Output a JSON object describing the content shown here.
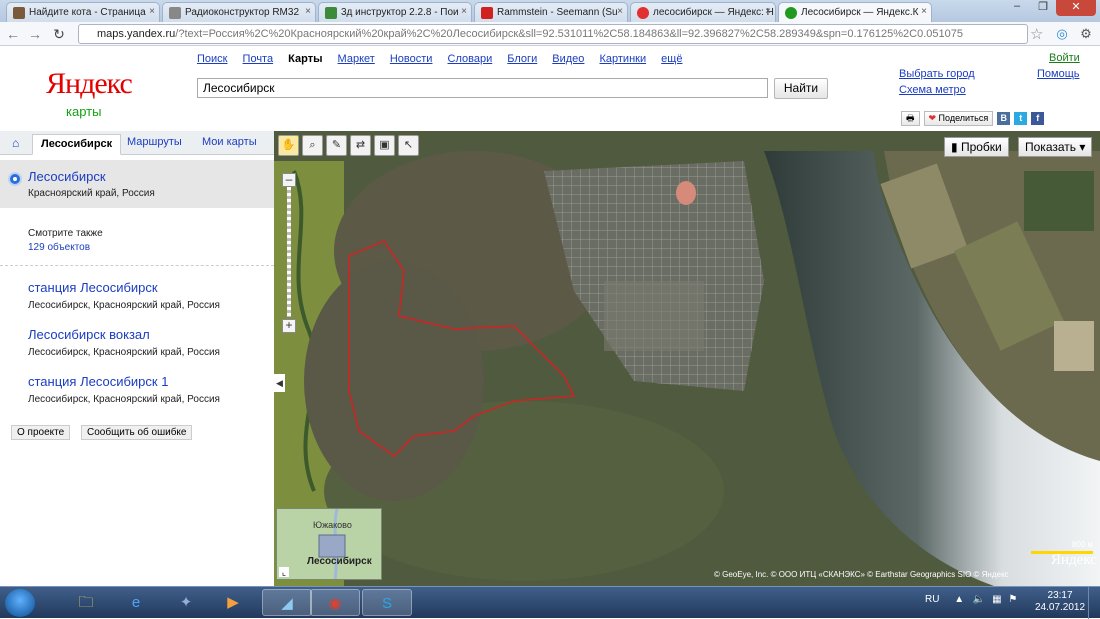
{
  "browser": {
    "tabs": [
      {
        "title": "Найдите кота - Страница",
        "favicon_color": "#7a5a3a"
      },
      {
        "title": "Радиоконструктор RM32",
        "favicon_color": "#888888"
      },
      {
        "title": "3д инструктор 2.2.8 - Пои",
        "favicon_color": "#3b8b3b"
      },
      {
        "title": "Rammstein - Seemann (Su",
        "favicon_color": "#d02020"
      },
      {
        "title": "лесосибирск — Яндекс: Н",
        "favicon_color": "#e03030"
      },
      {
        "title": "Лесосибирск — Яндекс.К",
        "favicon_color": "#1f9a1f"
      }
    ],
    "active_tab": 5,
    "url_host": "maps.yandex.ru",
    "url_rest": "/?text=Россия%2C%20Красноярский%20край%2C%20Лесосибирск&sll=92.531011%2C58.184863&ll=92.396827%2C58.289349&spn=0.176125%2C0.051075"
  },
  "header": {
    "logo_main": "Яндекс",
    "logo_sub": "карты",
    "services": [
      "Поиск",
      "Почта",
      "Карты",
      "Маркет",
      "Новости",
      "Словари",
      "Блоги",
      "Видео",
      "Картинки",
      "ещё"
    ],
    "current_service": "Карты",
    "search_value": "Лесосибирск",
    "find_button": "Найти",
    "choose_city": "Выбрать город",
    "metro_map": "Схема метро",
    "login": "Войти",
    "help": "Помощь",
    "share": "Поделиться"
  },
  "sidebar": {
    "tabs": [
      "Лесосибирск",
      "Маршруты",
      "Мои карты"
    ],
    "active_tab": "Лесосибирск",
    "selected": {
      "title": "Лесосибирск",
      "subtitle": "Красноярский край, Россия"
    },
    "see_also": "Смотрите также",
    "see_also_count": "129 объектов",
    "results": [
      {
        "title": "станция Лесосибирск",
        "subtitle": "Лесосибирск, Красноярский край, Россия"
      },
      {
        "title": "Лесосибирск вокзал",
        "subtitle": "Лесосибирск, Красноярский край, Россия"
      },
      {
        "title": "станция Лесосибирск 1",
        "subtitle": "Лесосибирск, Красноярский край, Россия"
      }
    ],
    "about": "О проекте",
    "report_error": "Сообщить об ошибке"
  },
  "map": {
    "traffic": "Пробки",
    "show": "Показать ▾",
    "scale_label": "800 м",
    "logo": "Яндекс",
    "copyright": "© GeoEye, Inc. © ООО ИТЦ «СКАНЭКС» © Earthstar Geographics SIO © Яндекс",
    "minimap_top": "Южаково",
    "minimap_city": "Лесосибирск"
  },
  "taskbar": {
    "lang": "RU",
    "time": "23:17",
    "date": "24.07.2012"
  }
}
